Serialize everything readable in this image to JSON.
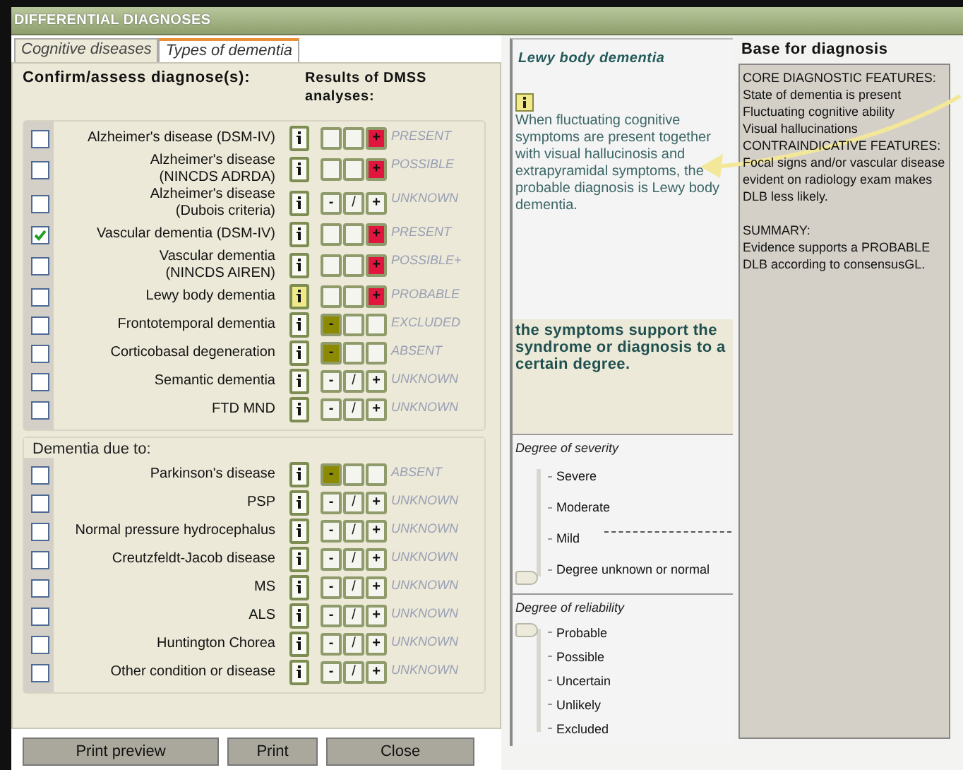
{
  "window": {
    "title": "DIFFERENTIAL DIAGNOSES"
  },
  "tabs": [
    {
      "label": "Cognitive diseases",
      "selected": false
    },
    {
      "label": "Types of dementia",
      "selected": true
    }
  ],
  "left_panel": {
    "heading": "Confirm/assess diagnose(s):",
    "results_heading": "Results of DMSS analyses:",
    "groups": [
      {
        "rows": [
          {
            "label": "Alzheimer's disease (DSM-IV)",
            "checked": false,
            "info_selected": false,
            "cells": [
              {
                "kind": "blank",
                "on": false
              },
              {
                "kind": "blank",
                "on": false
              },
              {
                "kind": "plus",
                "text": "+",
                "on": true
              }
            ],
            "result": "PRESENT"
          },
          {
            "label": "Alzheimer's disease\n(NINCDS ADRDA)",
            "checked": false,
            "info_selected": false,
            "cells": [
              {
                "kind": "blank",
                "on": false
              },
              {
                "kind": "blank",
                "on": false
              },
              {
                "kind": "plus",
                "text": "+",
                "on": true
              }
            ],
            "result": "POSSIBLE"
          },
          {
            "label": "Alzheimer's disease\n(Dubois criteria)",
            "checked": false,
            "info_selected": false,
            "cells": [
              {
                "kind": "minus",
                "text": "-",
                "on": false
              },
              {
                "kind": "slash",
                "text": "/",
                "on": false
              },
              {
                "kind": "plus",
                "text": "+",
                "on": false
              }
            ],
            "result": "UNKNOWN"
          },
          {
            "label": "Vascular dementia (DSM-IV)",
            "checked": true,
            "info_selected": false,
            "cells": [
              {
                "kind": "blank",
                "on": false
              },
              {
                "kind": "blank",
                "on": false
              },
              {
                "kind": "plus",
                "text": "+",
                "on": true
              }
            ],
            "result": "PRESENT"
          },
          {
            "label": "Vascular dementia\n(NINCDS AIREN)",
            "checked": false,
            "info_selected": false,
            "cells": [
              {
                "kind": "blank",
                "on": false
              },
              {
                "kind": "blank",
                "on": false
              },
              {
                "kind": "plus",
                "text": "+",
                "on": true
              }
            ],
            "result": "POSSIBLE+"
          },
          {
            "label": "Lewy body dementia",
            "checked": false,
            "info_selected": true,
            "cells": [
              {
                "kind": "blank",
                "on": false
              },
              {
                "kind": "blank",
                "on": false
              },
              {
                "kind": "plus",
                "text": "+",
                "on": true
              }
            ],
            "result": "PROBABLE"
          },
          {
            "label": "Frontotemporal dementia",
            "checked": false,
            "info_selected": false,
            "cells": [
              {
                "kind": "minus",
                "text": "-",
                "on": true
              },
              {
                "kind": "blank",
                "on": false
              },
              {
                "kind": "blank",
                "on": false
              }
            ],
            "result": "EXCLUDED"
          },
          {
            "label": "Corticobasal degeneration",
            "checked": false,
            "info_selected": false,
            "cells": [
              {
                "kind": "minus",
                "text": "-",
                "on": true
              },
              {
                "kind": "blank",
                "on": false
              },
              {
                "kind": "blank",
                "on": false
              }
            ],
            "result": "ABSENT"
          },
          {
            "label": "Semantic dementia",
            "checked": false,
            "info_selected": false,
            "cells": [
              {
                "kind": "minus",
                "text": "-",
                "on": false
              },
              {
                "kind": "slash",
                "text": "/",
                "on": false
              },
              {
                "kind": "plus",
                "text": "+",
                "on": false
              }
            ],
            "result": "UNKNOWN"
          },
          {
            "label": "FTD MND",
            "checked": false,
            "info_selected": false,
            "cells": [
              {
                "kind": "minus",
                "text": "-",
                "on": false
              },
              {
                "kind": "slash",
                "text": "/",
                "on": false
              },
              {
                "kind": "plus",
                "text": "+",
                "on": false
              }
            ],
            "result": "UNKNOWN"
          }
        ]
      },
      {
        "title": "Dementia due to:",
        "rows": [
          {
            "label": "Parkinson's disease",
            "checked": false,
            "info_selected": false,
            "cells": [
              {
                "kind": "minus",
                "text": "-",
                "on": true
              },
              {
                "kind": "blank",
                "on": false
              },
              {
                "kind": "blank",
                "on": false
              }
            ],
            "result": "ABSENT"
          },
          {
            "label": "PSP",
            "checked": false,
            "info_selected": false,
            "cells": [
              {
                "kind": "minus",
                "text": "-",
                "on": false
              },
              {
                "kind": "slash",
                "text": "/",
                "on": false
              },
              {
                "kind": "plus",
                "text": "+",
                "on": false
              }
            ],
            "result": "UNKNOWN"
          },
          {
            "label": "Normal pressure hydrocephalus",
            "checked": false,
            "info_selected": false,
            "cells": [
              {
                "kind": "minus",
                "text": "-",
                "on": false
              },
              {
                "kind": "slash",
                "text": "/",
                "on": false
              },
              {
                "kind": "plus",
                "text": "+",
                "on": false
              }
            ],
            "result": "UNKNOWN"
          },
          {
            "label": "Creutzfeldt-Jacob disease",
            "checked": false,
            "info_selected": false,
            "cells": [
              {
                "kind": "minus",
                "text": "-",
                "on": false
              },
              {
                "kind": "slash",
                "text": "/",
                "on": false
              },
              {
                "kind": "plus",
                "text": "+",
                "on": false
              }
            ],
            "result": "UNKNOWN"
          },
          {
            "label": "MS",
            "checked": false,
            "info_selected": false,
            "cells": [
              {
                "kind": "minus",
                "text": "-",
                "on": false
              },
              {
                "kind": "slash",
                "text": "/",
                "on": false
              },
              {
                "kind": "plus",
                "text": "+",
                "on": false
              }
            ],
            "result": "UNKNOWN"
          },
          {
            "label": "ALS",
            "checked": false,
            "info_selected": false,
            "cells": [
              {
                "kind": "minus",
                "text": "-",
                "on": false
              },
              {
                "kind": "slash",
                "text": "/",
                "on": false
              },
              {
                "kind": "plus",
                "text": "+",
                "on": false
              }
            ],
            "result": "UNKNOWN"
          },
          {
            "label": "Huntington Chorea",
            "checked": false,
            "info_selected": false,
            "cells": [
              {
                "kind": "minus",
                "text": "-",
                "on": false
              },
              {
                "kind": "slash",
                "text": "/",
                "on": false
              },
              {
                "kind": "plus",
                "text": "+",
                "on": false
              }
            ],
            "result": "UNKNOWN"
          },
          {
            "label": "Other condition or disease",
            "checked": false,
            "info_selected": false,
            "cells": [
              {
                "kind": "minus",
                "text": "-",
                "on": false
              },
              {
                "kind": "slash",
                "text": "/",
                "on": false
              },
              {
                "kind": "plus",
                "text": "+",
                "on": false
              }
            ],
            "result": "UNKNOWN"
          }
        ]
      }
    ]
  },
  "buttons": [
    "Print preview",
    "Print",
    "Close"
  ],
  "detail": {
    "title": "Lewy body dementia",
    "description": "When fluctuating cognitive symptoms are present together with visual hallucinosis and extrapyramidal symptoms, the probable diagnosis is Lewy body dementia.",
    "note": "the symptoms support the syndrome or diagnosis to a certain degree.",
    "severity": {
      "title": "Degree of severity",
      "labels": [
        "Severe",
        "Moderate",
        "Mild",
        "Degree unknown or normal"
      ],
      "level": 0
    },
    "reliability": {
      "title": "Degree of reliability",
      "labels": [
        "Probable",
        "Possible",
        "Uncertain",
        "Unlikely",
        "Excluded"
      ],
      "level": 1
    }
  },
  "basis": {
    "title": "Base for diagnosis",
    "sections": [
      {
        "lines": [
          "CORE DIAGNOSTIC FEATURES:",
          "State of dementia is present",
          "Fluctuating cognitive ability",
          "Visual hallucinations",
          "CONTRAINDICATIVE FEATURES:",
          "Focal signs and/or vascular disease evident on radiology exam makes DLB less likely."
        ]
      },
      {
        "lines": [
          "SUMMARY:",
          "Evidence supports a PROBABLE DLB according to consensusGL."
        ]
      }
    ]
  }
}
